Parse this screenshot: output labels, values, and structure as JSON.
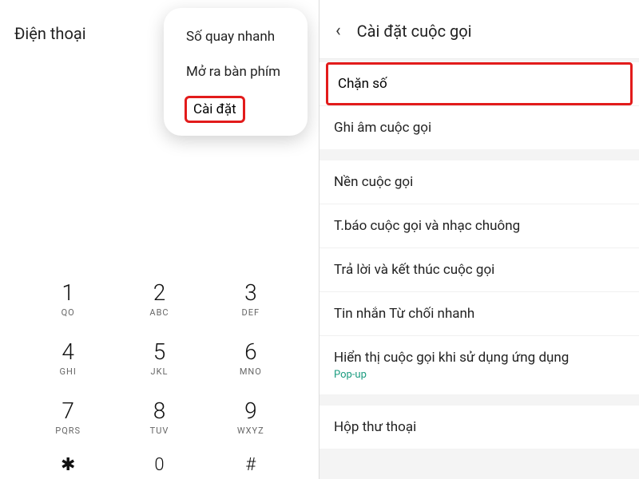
{
  "left": {
    "title": "Điện thoại",
    "popup": {
      "items": [
        "Số quay nhanh",
        "Mở ra bàn phím"
      ],
      "highlighted": "Cài đặt"
    },
    "keypad": [
      {
        "digit": "1",
        "sub": "QO"
      },
      {
        "digit": "2",
        "sub": "ABC"
      },
      {
        "digit": "3",
        "sub": "DEF"
      },
      {
        "digit": "4",
        "sub": "GHI"
      },
      {
        "digit": "5",
        "sub": "JKL"
      },
      {
        "digit": "6",
        "sub": "MNO"
      },
      {
        "digit": "7",
        "sub": "PQRS"
      },
      {
        "digit": "8",
        "sub": "TUV"
      },
      {
        "digit": "9",
        "sub": "WXYZ"
      },
      {
        "digit": "✱",
        "sub": ""
      },
      {
        "digit": "0",
        "sub": ""
      },
      {
        "digit": "#",
        "sub": ""
      }
    ]
  },
  "right": {
    "title": "Cài đặt cuộc gọi",
    "highlighted": "Chặn số",
    "group1": [
      "Ghi âm cuộc gọi"
    ],
    "group2": [
      {
        "label": "Nền cuộc gọi"
      },
      {
        "label": "T.báo cuộc gọi và nhạc chuông"
      },
      {
        "label": "Trả lời và kết thúc cuộc gọi"
      },
      {
        "label": "Tin nhắn Từ chối nhanh"
      },
      {
        "label": "Hiển thị cuộc gọi khi sử dụng ứng dụng",
        "sub": "Pop-up"
      }
    ],
    "group3": [
      "Hộp thư thoại"
    ]
  }
}
